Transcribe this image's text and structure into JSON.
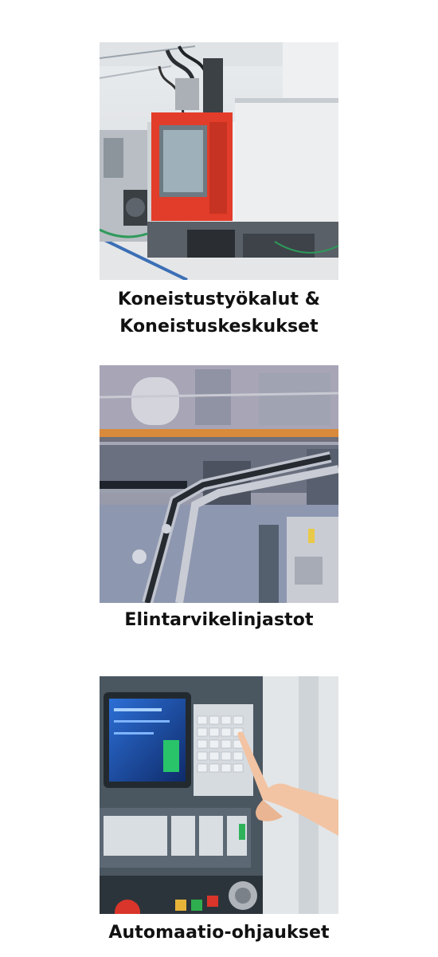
{
  "cards": [
    {
      "title_line1": "Koneistustyökalut &",
      "title_line2": "Koneistuskeskukset",
      "image_alt": ""
    },
    {
      "title": "Elintarvikelinjastot",
      "image_alt": ""
    },
    {
      "title": "Automaatio-ohjaukset",
      "image_alt": ""
    }
  ]
}
